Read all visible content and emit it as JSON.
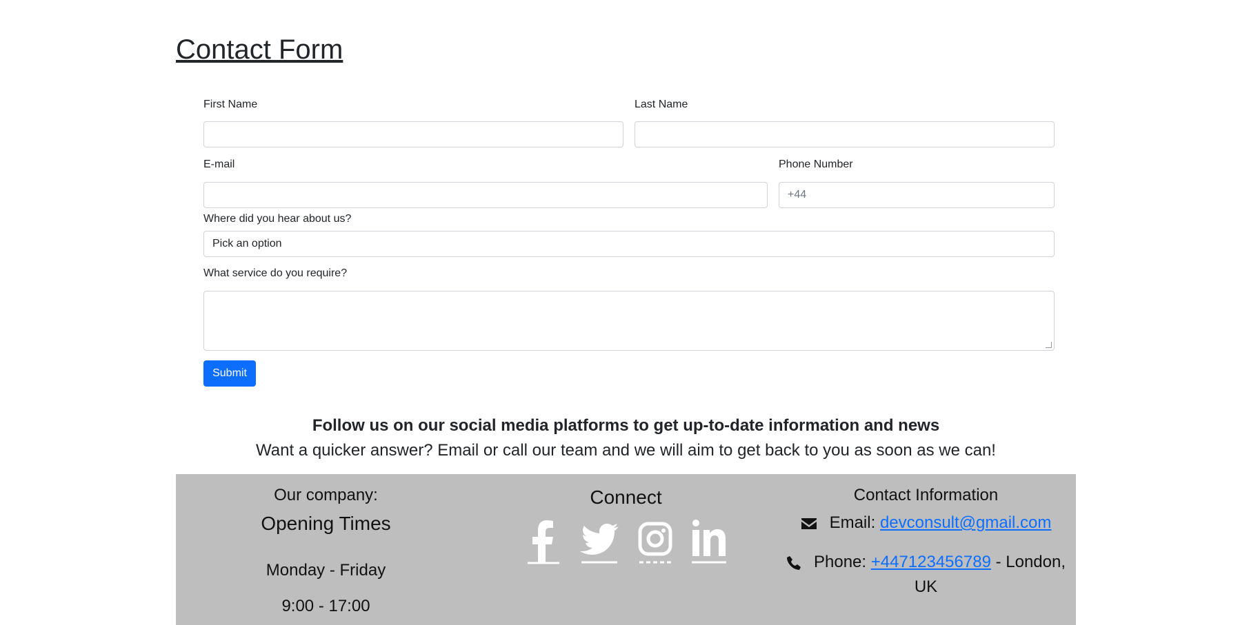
{
  "page": {
    "title": "Contact Form"
  },
  "form": {
    "first_name_label": "First Name",
    "last_name_label": "Last Name",
    "email_label": "E-mail",
    "phone_label": "Phone Number",
    "phone_placeholder": "+44",
    "hear_label": "Where did you hear about us?",
    "hear_selected": "Pick an option",
    "service_label": "What service do you require?",
    "submit_label": "Submit"
  },
  "promo": {
    "follow_text": "Follow us on our social media platforms to get up-to-date information and news",
    "quick_text": "Want a quicker answer? Email or call our team and we will aim to get back to you as soon as we can!"
  },
  "footer": {
    "company_label": "Our company:",
    "opening_title": "Opening Times",
    "days": "Monday - Friday",
    "hours": "9:00 - 17:00",
    "connect_title": "Connect",
    "social_icons": [
      "facebook-icon",
      "twitter-icon",
      "instagram-icon",
      "linkedin-icon"
    ],
    "contact_title": "Contact Information",
    "email_prefix": "Email:",
    "email_value": "devconsult@gmail.com",
    "phone_prefix": "Phone:",
    "phone_value": "+447123456789",
    "phone_suffix": "- London,",
    "phone_suffix2": "UK"
  },
  "colors": {
    "primary": "#0d6efd",
    "footer_bg": "#bebebe",
    "text": "#212529"
  }
}
